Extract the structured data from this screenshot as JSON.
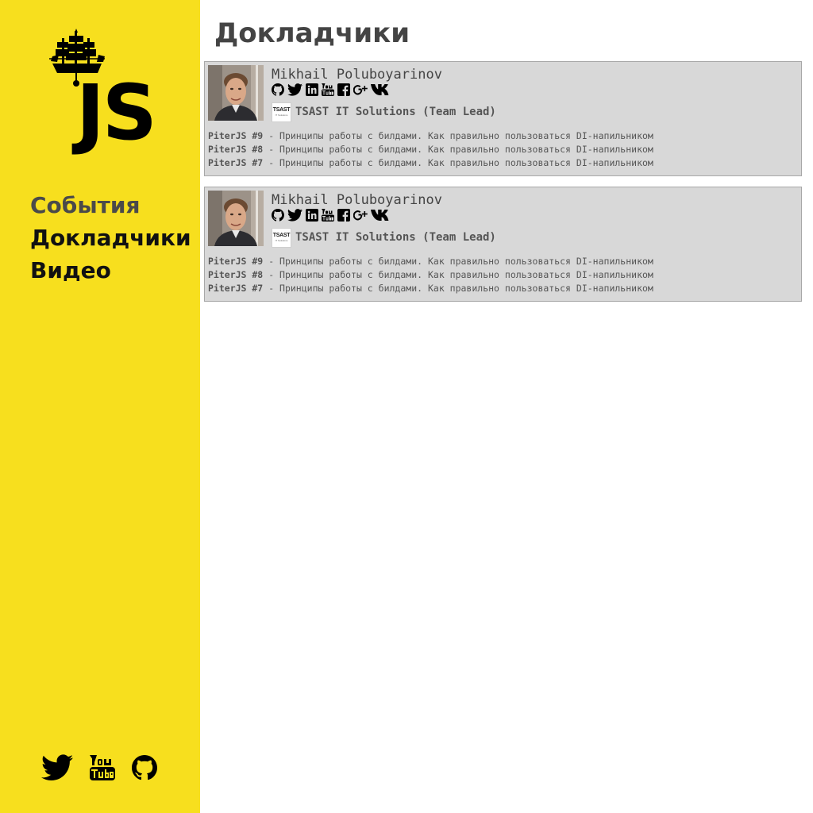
{
  "brand": {
    "logo_text": "JS",
    "color": "#f7df1e"
  },
  "nav": [
    {
      "label": "События",
      "state": "muted"
    },
    {
      "label": "Докладчики",
      "state": "active"
    },
    {
      "label": "Видео",
      "state": "active"
    }
  ],
  "footer_social": [
    "twitter-icon",
    "youtube-icon",
    "github-icon"
  ],
  "page": {
    "title": "Докладчики"
  },
  "speakers": [
    {
      "name": "Mikhail Poluboyarinov",
      "links": [
        "github-icon",
        "twitter-icon",
        "linkedin-icon",
        "youtube-icon",
        "facebook-icon",
        "google-plus-icon",
        "vk-icon"
      ],
      "company": {
        "logo_text": "TSAST",
        "logo_subtext": "IT Solutions",
        "name": "TSAST IT Solutions (Team Lead)"
      },
      "talks": [
        {
          "event": "PiterJS #9",
          "title": "- Принципы работы с билдами. Как правильно пользоваться DI-напильником"
        },
        {
          "event": "PiterJS #8",
          "title": "- Принципы работы с билдами. Как правильно пользоваться DI-напильником"
        },
        {
          "event": "PiterJS #7",
          "title": "- Принципы работы с билдами. Как правильно пользоваться DI-напильником"
        }
      ]
    },
    {
      "name": "Mikhail Poluboyarinov",
      "links": [
        "github-icon",
        "twitter-icon",
        "linkedin-icon",
        "youtube-icon",
        "facebook-icon",
        "google-plus-icon",
        "vk-icon"
      ],
      "company": {
        "logo_text": "TSAST",
        "logo_subtext": "IT Solutions",
        "name": "TSAST IT Solutions (Team Lead)"
      },
      "talks": [
        {
          "event": "PiterJS #9",
          "title": "- Принципы работы с билдами. Как правильно пользоваться DI-напильником"
        },
        {
          "event": "PiterJS #8",
          "title": "- Принципы работы с билдами. Как правильно пользоваться DI-напильником"
        },
        {
          "event": "PiterJS #7",
          "title": "- Принципы работы с билдами. Как правильно пользоваться DI-напильником"
        }
      ]
    }
  ]
}
